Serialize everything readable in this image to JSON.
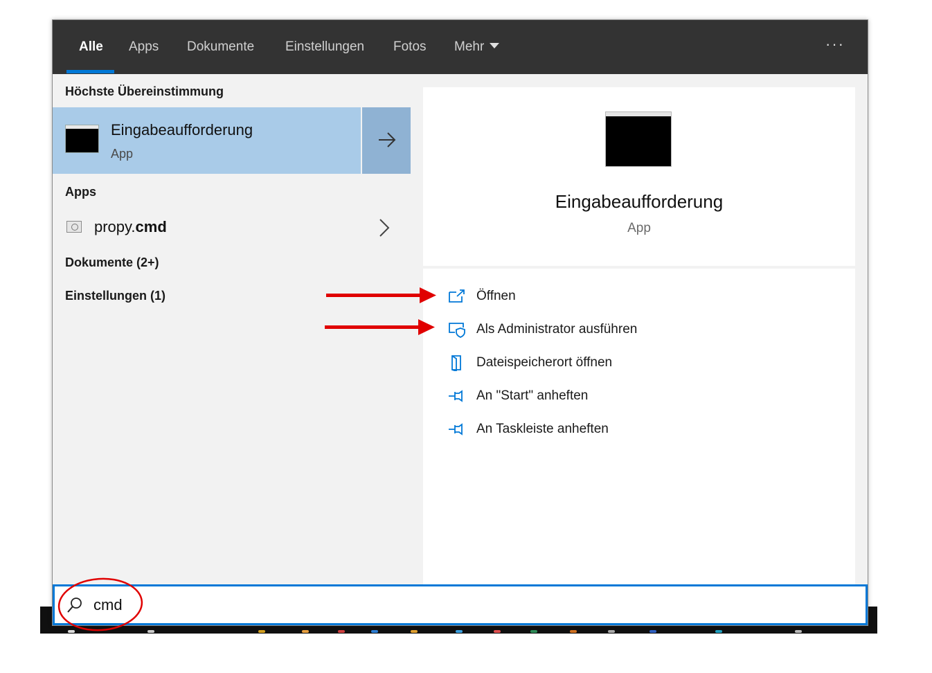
{
  "tabs": [
    {
      "label": "Alle",
      "active": true
    },
    {
      "label": "Apps"
    },
    {
      "label": "Dokumente"
    },
    {
      "label": "Einstellungen"
    },
    {
      "label": "Fotos"
    },
    {
      "label": "Mehr"
    }
  ],
  "more_label": "···",
  "left": {
    "best_match_heading": "Höchste Übereinstimmung",
    "best_match": {
      "title": "Eingabeaufforderung",
      "subtitle": "App",
      "icon": "command-prompt-icon"
    },
    "apps_heading": "Apps",
    "app_item": {
      "name_prefix": "propy.",
      "name_highlight": "cmd",
      "icon": "script-file-icon"
    },
    "documents_heading": "Dokumente (2+)",
    "settings_heading": "Einstellungen (1)"
  },
  "preview": {
    "title": "Eingabeaufforderung",
    "subtitle": "App",
    "icon": "command-prompt-icon"
  },
  "actions": [
    {
      "label": "Öffnen",
      "icon": "open-icon"
    },
    {
      "label": "Als Administrator ausführen",
      "icon": "run-as-admin-icon"
    },
    {
      "label": "Dateispeicherort öffnen",
      "icon": "file-location-icon"
    },
    {
      "label": "An \"Start\" anheften",
      "icon": "pin-icon"
    },
    {
      "label": "An Taskleiste anheften",
      "icon": "pin-icon"
    }
  ],
  "search": {
    "value": "cmd"
  },
  "colors": {
    "accent": "#0078d7",
    "topbar": "#333333",
    "selected": "#a9cbe8",
    "annotation": "#e00000"
  }
}
